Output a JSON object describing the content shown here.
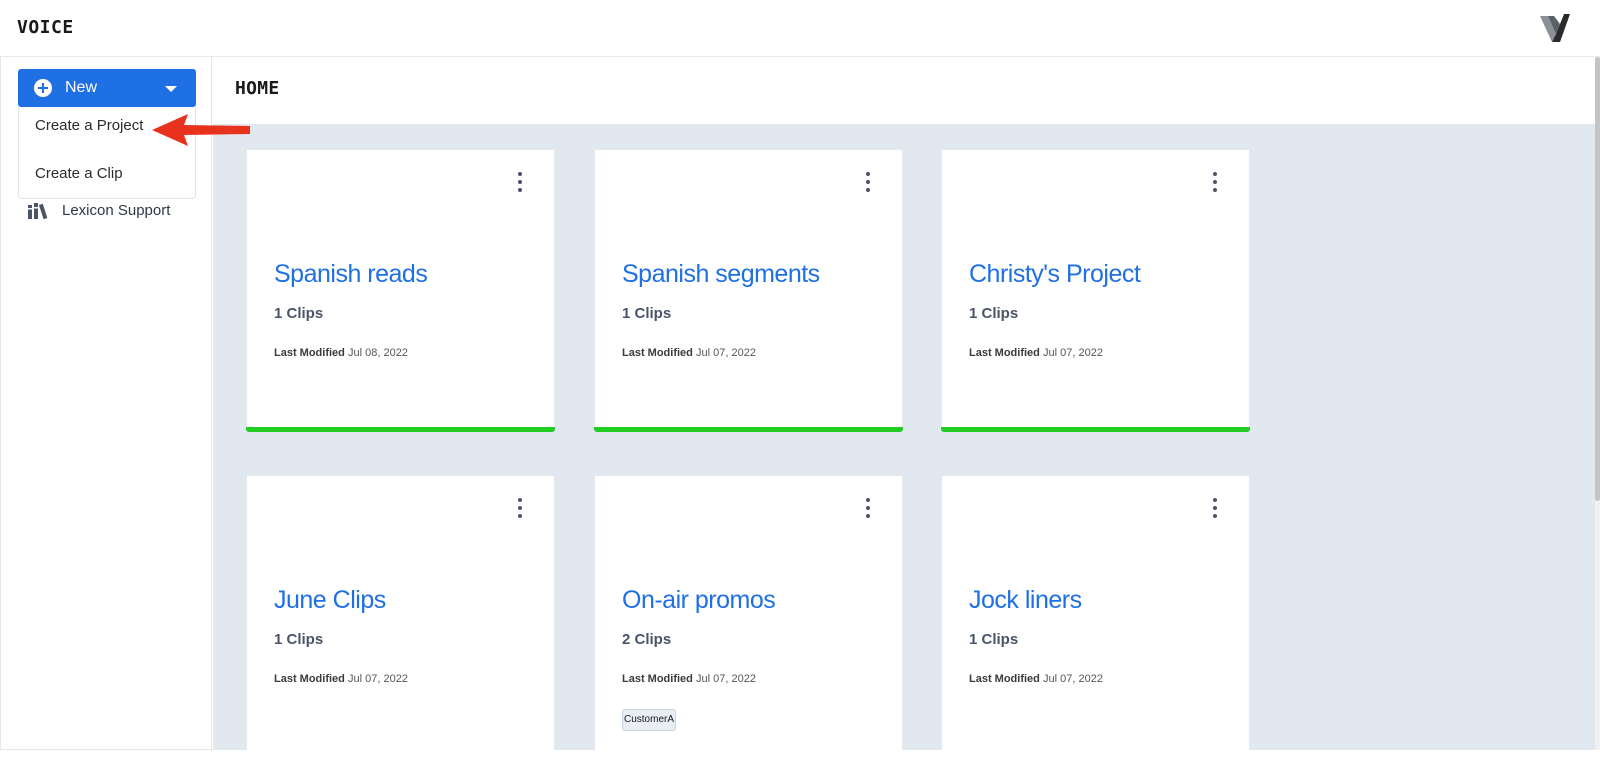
{
  "app": {
    "title": "VOICE"
  },
  "sidebar": {
    "new_button": "New",
    "dropdown": [
      "Create a Project",
      "Create a Clip"
    ],
    "items": [
      {
        "label": "Lexicon Support",
        "icon": "books-icon"
      }
    ]
  },
  "page": {
    "title": "HOME"
  },
  "cards": [
    {
      "title": "Spanish reads",
      "clips": "1 Clips",
      "modified_label": "Last Modified",
      "modified": "Jul 08, 2022",
      "status_color": "#22cc22"
    },
    {
      "title": "Spanish segments",
      "clips": "1 Clips",
      "modified_label": "Last Modified",
      "modified": "Jul 07, 2022",
      "status_color": "#22cc22"
    },
    {
      "title": "Christy's Project",
      "clips": "1 Clips",
      "modified_label": "Last Modified",
      "modified": "Jul 07, 2022",
      "status_color": "#22cc22"
    },
    {
      "title": "June Clips",
      "clips": "1 Clips",
      "modified_label": "Last Modified",
      "modified": "Jul 07, 2022"
    },
    {
      "title": "On-air promos",
      "clips": "2 Clips",
      "modified_label": "Last Modified",
      "modified": "Jul 07, 2022",
      "tag": "CustomerA"
    },
    {
      "title": "Jock liners",
      "clips": "1 Clips",
      "modified_label": "Last Modified",
      "modified": "Jul 07, 2022"
    }
  ],
  "colors": {
    "accent": "#1f6fe5",
    "status_ok": "#22cc22",
    "content_bg": "#e1e8f0",
    "annotation": "#e8321e"
  }
}
